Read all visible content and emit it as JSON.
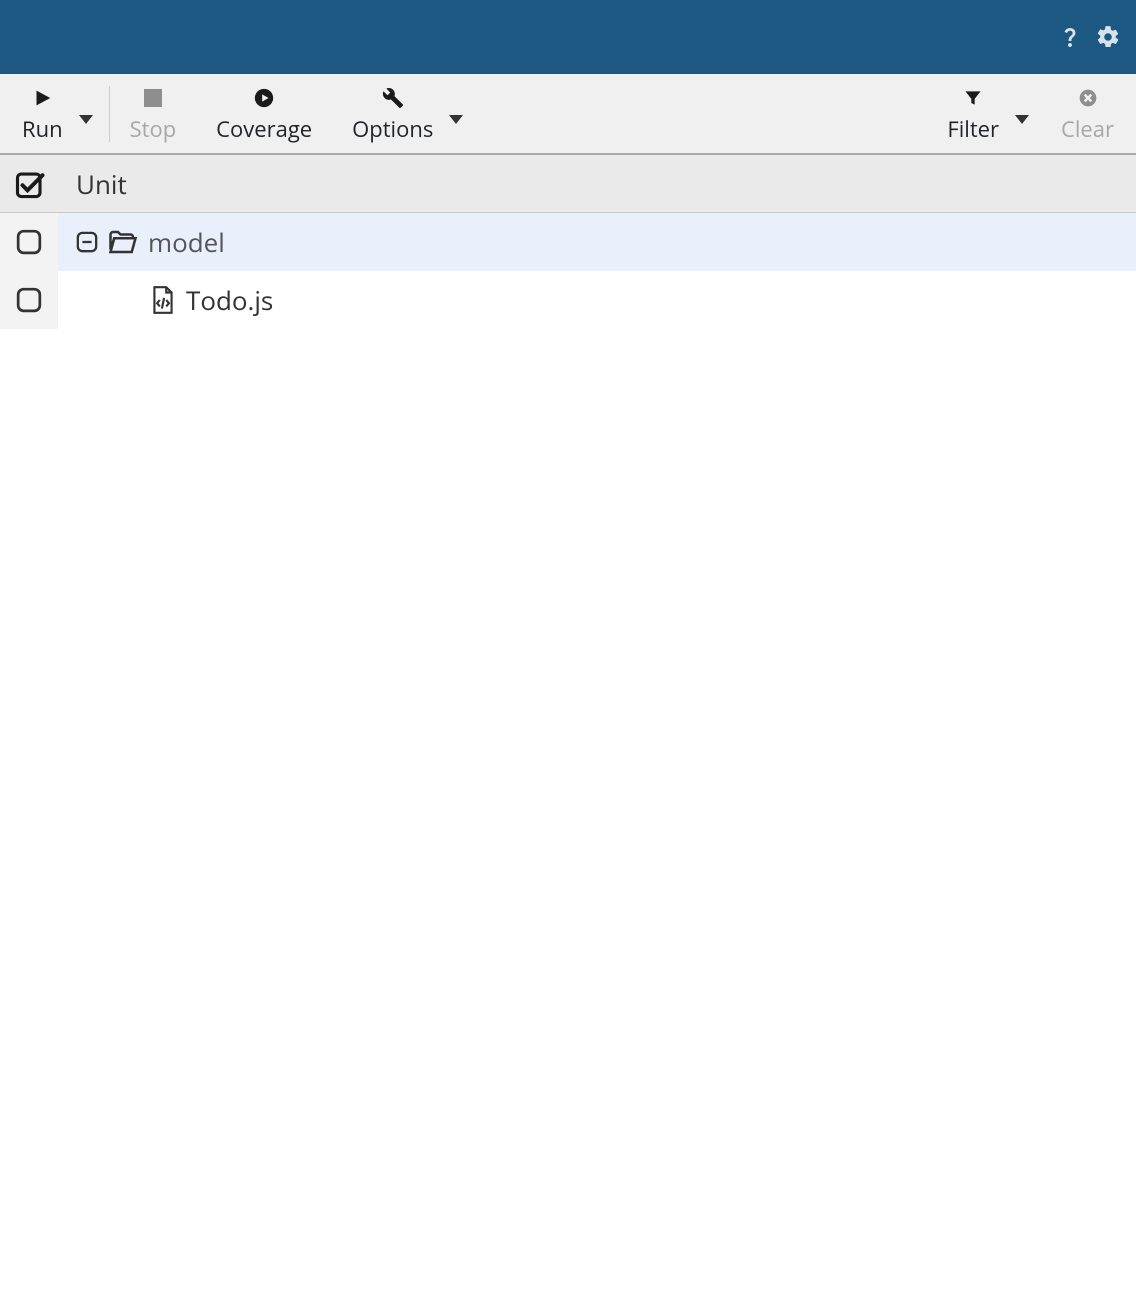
{
  "header": {
    "help_icon": "help-icon",
    "settings_icon": "settings-gear-icon"
  },
  "toolbar": {
    "run": "Run",
    "stop": "Stop",
    "coverage": "Coverage",
    "options": "Options",
    "filter": "Filter",
    "clear": "Clear"
  },
  "group": {
    "label": "Unit"
  },
  "tree": {
    "folder": {
      "name": "model"
    },
    "file": {
      "name": "Todo.js"
    }
  }
}
